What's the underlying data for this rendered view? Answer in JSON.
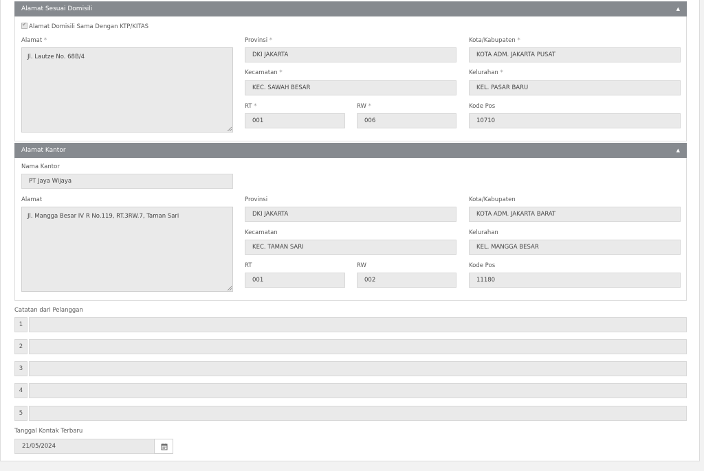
{
  "domisili": {
    "title": "Alamat Sesuai Domisili",
    "same_checkbox_label": "Alamat Domisili Sama Dengan KTP/KITAS",
    "same_checked": true,
    "alamat_label": "Alamat",
    "alamat_value": "Jl. Lautze No. 68B/4",
    "provinsi_label": "Provinsi",
    "provinsi_value": "DKI JAKARTA",
    "kota_label": "Kota/Kabupaten",
    "kota_value": "KOTA ADM. JAKARTA PUSAT",
    "kecamatan_label": "Kecamatan",
    "kecamatan_value": "KEC. SAWAH BESAR",
    "kelurahan_label": "Kelurahan",
    "kelurahan_value": "KEL. PASAR BARU",
    "rt_label": "RT",
    "rt_value": "001",
    "rw_label": "RW",
    "rw_value": "006",
    "kodepos_label": "Kode Pos",
    "kodepos_value": "10710",
    "required_mark": "*"
  },
  "kantor": {
    "title": "Alamat Kantor",
    "nama_label": "Nama Kantor",
    "nama_value": "PT Jaya Wijaya",
    "alamat_label": "Alamat",
    "alamat_value": "Jl. Mangga Besar IV R No.119, RT.3RW.7, Taman Sari",
    "provinsi_label": "Provinsi",
    "provinsi_value": "DKI JAKARTA",
    "kota_label": "Kota/Kabupaten",
    "kota_value": "KOTA ADM. JAKARTA BARAT",
    "kecamatan_label": "Kecamatan",
    "kecamatan_value": "KEC. TAMAN SARI",
    "kelurahan_label": "Kelurahan",
    "kelurahan_value": "KEL. MANGGA BESAR",
    "rt_label": "RT",
    "rt_value": "001",
    "rw_label": "RW",
    "rw_value": "002",
    "kodepos_label": "Kode Pos",
    "kodepos_value": "11180"
  },
  "catatan": {
    "label": "Catatan dari Pelanggan",
    "rows": [
      {
        "num": "1",
        "value": ""
      },
      {
        "num": "2",
        "value": ""
      },
      {
        "num": "3",
        "value": ""
      },
      {
        "num": "4",
        "value": ""
      },
      {
        "num": "5",
        "value": ""
      }
    ]
  },
  "kontak": {
    "label": "Tanggal Kontak Terbaru",
    "value": "21/05/2024"
  },
  "icons": {
    "collapse": "caret-up-icon",
    "calendar": "calendar-icon"
  }
}
